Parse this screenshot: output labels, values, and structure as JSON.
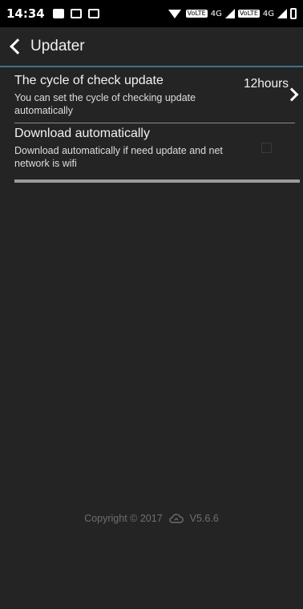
{
  "status_bar": {
    "time": "14:34",
    "volte1": "VoLTE",
    "net1": "4G",
    "volte2": "VoLTE",
    "net2": "4G"
  },
  "app_bar": {
    "title": "Updater"
  },
  "settings": {
    "cycle": {
      "title": "The cycle of check update",
      "description": "You can set the cycle of checking update automatically",
      "value": "12hours"
    },
    "download": {
      "title": "Download automatically",
      "description": "Download automatically if need update and net network is wifi",
      "checked": false
    }
  },
  "footer": {
    "copyright": "Copyright © 2017",
    "version": "V5.6.6"
  },
  "colors": {
    "accent": "#3e6f8c",
    "background": "#242424",
    "status_bar": "#000000"
  }
}
